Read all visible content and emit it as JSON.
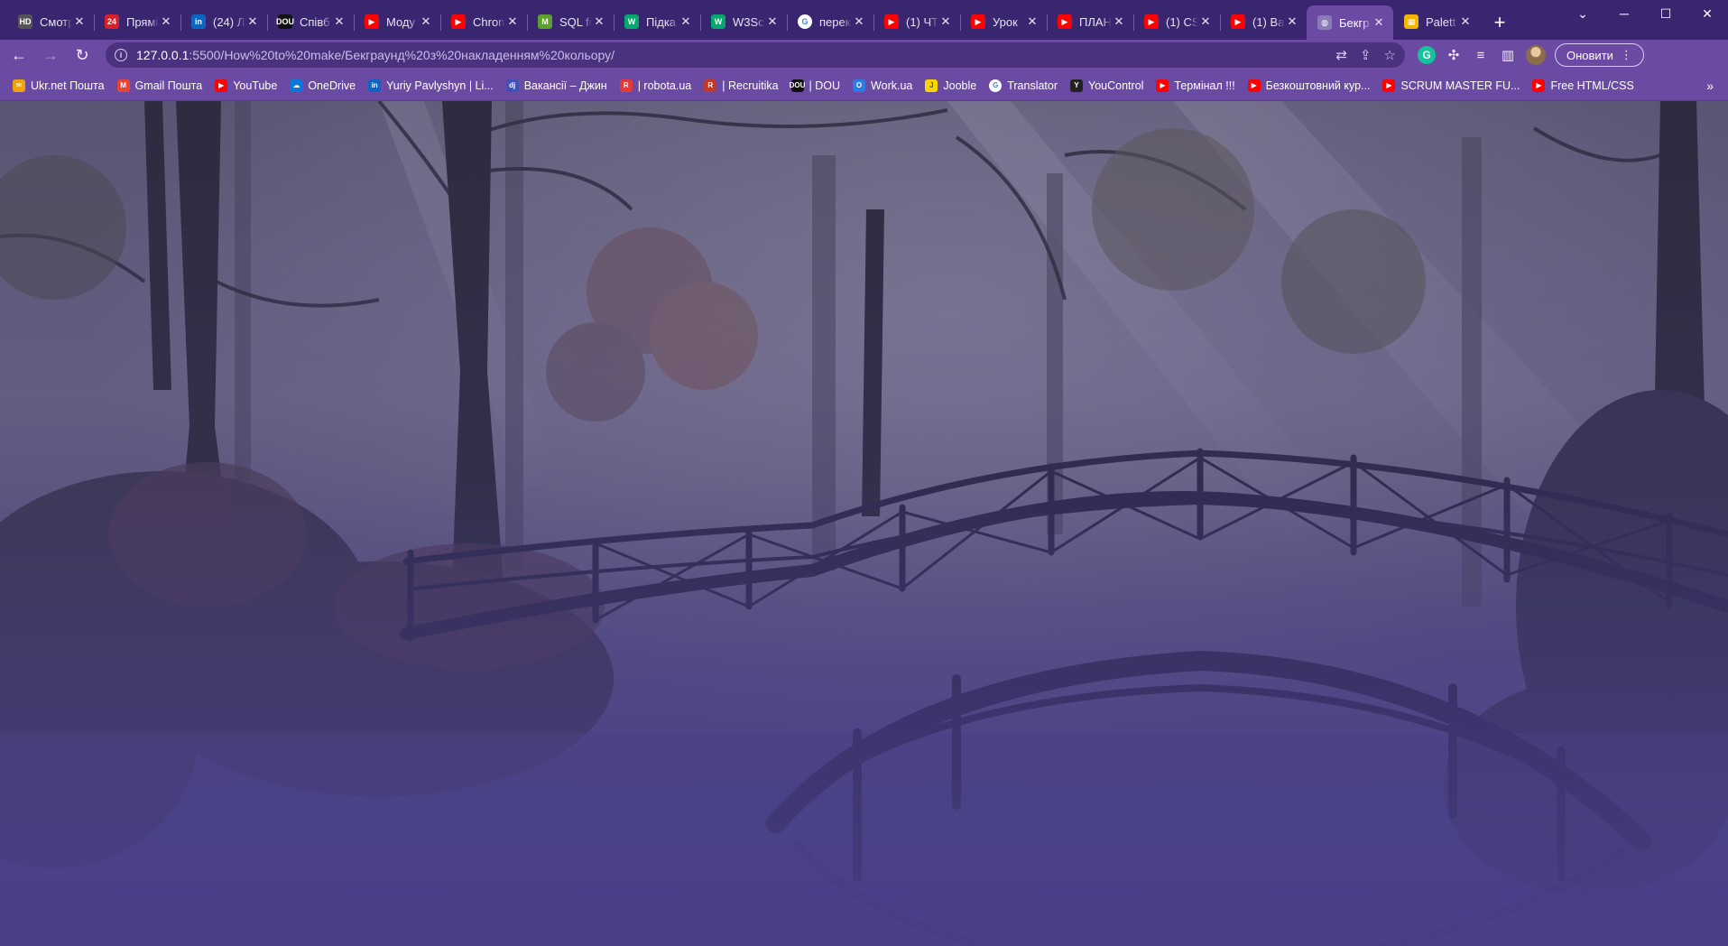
{
  "browser": {
    "tabs": [
      {
        "title": "Смотр",
        "icon": "hd-icon",
        "color": "#555555",
        "glyph": "HD"
      },
      {
        "title": "Прямі",
        "icon": "24-news-icon",
        "color": "#d6202a",
        "glyph": "24"
      },
      {
        "title": "(24) Л",
        "icon": "linkedin-icon",
        "color": "#0a66c2",
        "glyph": "in"
      },
      {
        "title": "Співб",
        "icon": "dou-icon",
        "color": "#111111",
        "glyph": "DOU"
      },
      {
        "title": "Моду",
        "icon": "youtube-icon",
        "color": "#ff0000",
        "glyph": "▶"
      },
      {
        "title": "Chron",
        "icon": "youtube-icon",
        "color": "#ff0000",
        "glyph": "▶"
      },
      {
        "title": "SQL fo",
        "icon": "m-icon",
        "color": "#5aa02c",
        "glyph": "M"
      },
      {
        "title": "Підка",
        "icon": "w3schools-icon",
        "color": "#04aa6d",
        "glyph": "W"
      },
      {
        "title": "W3Sc",
        "icon": "w3schools-icon",
        "color": "#04aa6d",
        "glyph": "W"
      },
      {
        "title": "перек",
        "icon": "google-icon",
        "color": "#ffffff",
        "glyph": "G"
      },
      {
        "title": "(1) ЧТ",
        "icon": "youtube-icon",
        "color": "#ff0000",
        "glyph": "▶"
      },
      {
        "title": "Урок",
        "icon": "youtube-icon",
        "color": "#ff0000",
        "glyph": "▶"
      },
      {
        "title": "ПЛАН",
        "icon": "youtube-icon",
        "color": "#ff0000",
        "glyph": "▶"
      },
      {
        "title": "(1) CS",
        "icon": "youtube-icon",
        "color": "#ff0000",
        "glyph": "▶"
      },
      {
        "title": "(1) Ва",
        "icon": "youtube-icon",
        "color": "#ff0000",
        "glyph": "▶"
      },
      {
        "title": "Бекгр",
        "icon": "globe-icon",
        "color": "#8a7bb8",
        "glyph": "◍",
        "active": true
      },
      {
        "title": "Palett",
        "icon": "palette-icon",
        "color": "#f4b400",
        "glyph": "▦"
      }
    ],
    "new_tab": "+",
    "window": {
      "minimize": "─",
      "maximize": "☐",
      "close": "✕",
      "dropdown": "⌄"
    },
    "url_host": "127.0.0.1",
    "url_path": ":5500/How%20to%20make/Бекграунд%20з%20накладенням%20кольору/",
    "update_label": "Оновити"
  },
  "bookmarks": [
    {
      "label": "Ukr.net Пошта",
      "icon": "ukrnet-icon",
      "color": "#f0a30a",
      "glyph": "✉"
    },
    {
      "label": "Gmail Пошта",
      "icon": "gmail-icon",
      "color": "#ea4335",
      "glyph": "M"
    },
    {
      "label": "YouTube",
      "icon": "youtube-icon",
      "color": "#ff0000",
      "glyph": "▶"
    },
    {
      "label": "OneDrive",
      "icon": "onedrive-icon",
      "color": "#0a78d7",
      "glyph": "☁"
    },
    {
      "label": "Yuriy Pavlyshyn | Li...",
      "icon": "linkedin-icon",
      "color": "#0a66c2",
      "glyph": "in"
    },
    {
      "label": "Вакансії – Джин",
      "icon": "djinni-icon",
      "color": "#3f51b5",
      "glyph": "dj"
    },
    {
      "label": "| robota.ua",
      "icon": "robota-icon",
      "color": "#e53935",
      "glyph": "R"
    },
    {
      "label": "| Recruitika",
      "icon": "recruitika-icon",
      "color": "#c0392b",
      "glyph": "R"
    },
    {
      "label": "| DOU",
      "icon": "dou-icon",
      "color": "#111111",
      "glyph": "DOU"
    },
    {
      "label": "Work.ua",
      "icon": "workua-icon",
      "color": "#2d7be5",
      "glyph": "O"
    },
    {
      "label": "Jooble",
      "icon": "jooble-icon",
      "color": "#ffd500",
      "glyph": "J"
    },
    {
      "label": "Translator",
      "icon": "google-icon",
      "color": "#ffffff",
      "glyph": "G"
    },
    {
      "label": "YouControl",
      "icon": "youcontrol-icon",
      "color": "#222222",
      "glyph": "Y"
    },
    {
      "label": "Термінал !!!",
      "icon": "youtube-icon",
      "color": "#ff0000",
      "glyph": "▶"
    },
    {
      "label": "Безкоштовний кур...",
      "icon": "youtube-icon",
      "color": "#ff0000",
      "glyph": "▶"
    },
    {
      "label": "SCRUM MASTER FU...",
      "icon": "youtube-icon",
      "color": "#ff0000",
      "glyph": "▶"
    },
    {
      "label": "Free HTML/CSS",
      "icon": "youtube-icon",
      "color": "#ff0000",
      "glyph": "▶"
    }
  ],
  "theme": {
    "overlay_color": "#4a3f8c",
    "tabstrip": "#3a2570",
    "toolbar": "#6a4aa3"
  }
}
